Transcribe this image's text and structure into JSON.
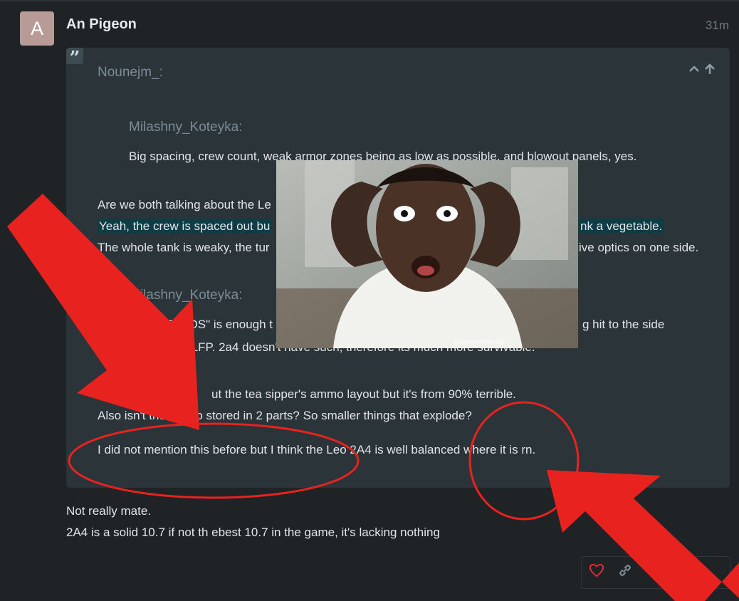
{
  "post": {
    "avatar_letter": "A",
    "username": "An Pigeon",
    "time": "31m"
  },
  "quote": {
    "author": "Nounejm_:",
    "nested1": {
      "author": "Milashny_Koteyka:",
      "text": "Big spacing, crew count, weak armor zones being as low as possible, and blowout panels, yes."
    },
    "lines": [
      "Are we both talking about the Le",
      "Yeah, the crew is spaced out bu",
      "nk a vegetable.",
      "The whole tank is weaky, the tur",
      "ive optics on one side."
    ],
    "nested2": {
      "author": "Milashny_Koteyka:",
      "line1_left": "ly APFSDS\" is enough t",
      "line1_right": "g hit to the side",
      "line2": "he LFP. 2a4 doesn't have such, therefore its much more survivable."
    },
    "tail_lines": [
      "ut the tea sipper's ammo layout but it's from 90% terrible.",
      "Also isn't the ammo stored in 2 parts? So smaller things that explode?",
      "I did not mention this before but I think the Leo 2A4 is well balanced where it is rn."
    ],
    "tail_prefix": "I"
  },
  "reply": {
    "line1": "Not really mate.",
    "line2": "2A4 is a solid 10.7 if not th ebest 10.7 in the game, it's lacking nothing"
  },
  "meme": {
    "watermark": "@peremen.e2"
  },
  "icons": {
    "quote": "quote-icon",
    "collapse": "chevron-up-icon",
    "jump": "arrow-up-icon",
    "like": "heart-icon",
    "link": "link-icon"
  },
  "colors": {
    "background": "#1f2326",
    "quote_bg": "#2b3439",
    "highlight": "#0f3c45",
    "annotation_red": "#e8221f"
  }
}
